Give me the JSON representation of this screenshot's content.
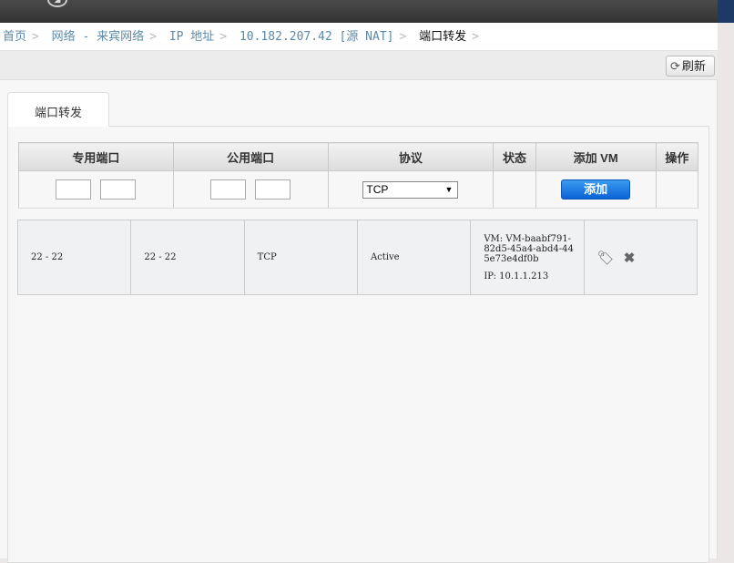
{
  "breadcrumb": [
    {
      "label": "首页",
      "link": true
    },
    {
      "label": "网络 - 来宾网络",
      "link": true
    },
    {
      "label": "IP 地址",
      "link": true
    },
    {
      "label": "10.182.207.42 [源 NAT]",
      "link": true
    },
    {
      "label": "端口转发",
      "link": false
    }
  ],
  "toolbar": {
    "refresh_label": "刷新",
    "refresh_icon": "refresh-icon"
  },
  "tab": {
    "label": "端口转发"
  },
  "table": {
    "headers": [
      "专用端口",
      "公用端口",
      "协议",
      "状态",
      "添加 VM",
      "操作"
    ],
    "form": {
      "protocol": "TCP",
      "add_label": "添加"
    },
    "rows": [
      {
        "private": "22 - 22",
        "public": "22 - 22",
        "protocol": "TCP",
        "state": "Active",
        "vm": "VM: VM-baabf791-82d5-45a4-abd4-445e73e4df0b",
        "ip": "IP: 10.1.1.213",
        "actions": [
          "tag-icon",
          "close-icon"
        ]
      }
    ]
  },
  "colors": {
    "link": "#5b8aa8",
    "add_button": "#0a63d6",
    "topbar": "#3a3a3a"
  }
}
